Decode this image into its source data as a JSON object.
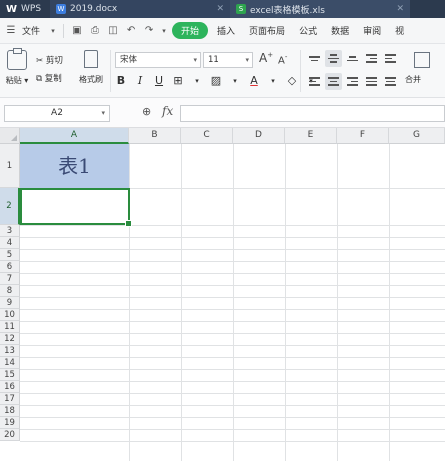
{
  "tabs": [
    {
      "label": "WPS",
      "icon": "wps-logo-icon"
    },
    {
      "label": "2019.docx",
      "icon": "word-doc-icon"
    },
    {
      "label": "excel表格模板.xls",
      "icon": "spreadsheet-file-icon"
    }
  ],
  "menu": {
    "file_label": "文件",
    "start_label": "开始",
    "insert_label": "插入",
    "page_layout_label": "页面布局",
    "formula_label": "公式",
    "data_label": "数据",
    "review_label": "审阅",
    "more_label": "视"
  },
  "toolbar": {
    "paste_label": "粘贴",
    "cut_label": "剪切",
    "copy_label": "复制",
    "format_painter_label": "格式刷",
    "font_name": "宋体",
    "font_size": "11",
    "merge_label": "合并"
  },
  "formula_bar": {
    "name_box": "A2",
    "fx_label": "fx",
    "content": ""
  },
  "sheet": {
    "columns": [
      "A",
      "B",
      "C",
      "D",
      "E",
      "F",
      "G"
    ],
    "rows": [
      "1",
      "2",
      "3",
      "4",
      "5",
      "6",
      "7",
      "8",
      "9",
      "10",
      "11",
      "12",
      "13",
      "14",
      "15",
      "16",
      "17",
      "18",
      "19",
      "20"
    ],
    "cell_a1": "表1",
    "active_cell": "A2"
  },
  "colors": {
    "accent_green": "#2db45c",
    "selection_fill": "#b7cbe8",
    "active_border": "#2a8c3e"
  }
}
